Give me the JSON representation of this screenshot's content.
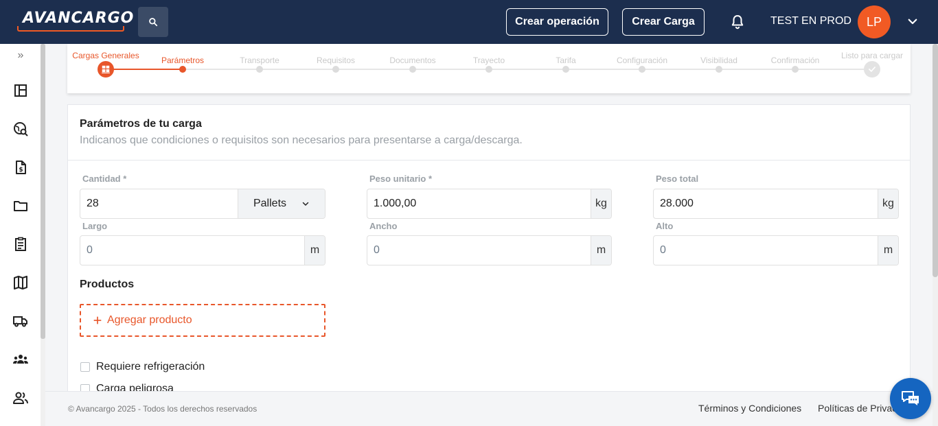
{
  "header": {
    "logo_text": "AVANCARGO",
    "create_operation": "Crear operación",
    "create_load": "Crear Carga",
    "user_name": "TEST EN PROD",
    "avatar_initials": "LP"
  },
  "sidebar": {
    "expand": "»",
    "items": [
      "dashboard-icon",
      "search-globe-icon",
      "invoice-icon",
      "folder-icon",
      "clipboard-icon",
      "map-icon",
      "truck-icon",
      "group-icon",
      "users-icon"
    ]
  },
  "stepper": {
    "steps": [
      {
        "label": "Cargas Generales",
        "state": "done"
      },
      {
        "label": "Parámetros",
        "state": "active"
      },
      {
        "label": "Transporte",
        "state": "pending"
      },
      {
        "label": "Requisitos",
        "state": "pending"
      },
      {
        "label": "Documentos",
        "state": "pending"
      },
      {
        "label": "Trayecto",
        "state": "pending"
      },
      {
        "label": "Tarifa",
        "state": "pending"
      },
      {
        "label": "Configuración",
        "state": "pending"
      },
      {
        "label": "Visibilidad",
        "state": "pending"
      },
      {
        "label": "Confirmación",
        "state": "pending"
      },
      {
        "label": "Listo para cargar",
        "state": "pending"
      }
    ]
  },
  "form": {
    "title": "Parámetros de tu carga",
    "subtitle": "Indicanos que condiciones o requisitos son necesarios para presentarse a carga/descarga.",
    "cantidad": {
      "label": "Cantidad *",
      "value": "28",
      "unit": "Pallets"
    },
    "peso_unitario": {
      "label": "Peso unitario *",
      "value": "1.000,00",
      "unit": "kg"
    },
    "peso_total": {
      "label": "Peso total",
      "value": "28.000",
      "unit": "kg"
    },
    "largo": {
      "label": "Largo",
      "value": "0",
      "unit": "m"
    },
    "ancho": {
      "label": "Ancho",
      "value": "0",
      "unit": "m"
    },
    "alto": {
      "label": "Alto",
      "value": "0",
      "unit": "m"
    },
    "products_title": "Productos",
    "add_product": "Agregar producto",
    "refrigeration": "Requiere refrigeración",
    "dangerous": "Carga peligrosa"
  },
  "footer": {
    "copyright": "© Avancargo 2025 - Todos los derechos reservados",
    "terms": "Términos y Condiciones",
    "privacy": "Políticas de Privacidad"
  },
  "colors": {
    "header_bg": "#1c2e4e",
    "accent": "#e8562a",
    "chat": "#1565c0"
  }
}
